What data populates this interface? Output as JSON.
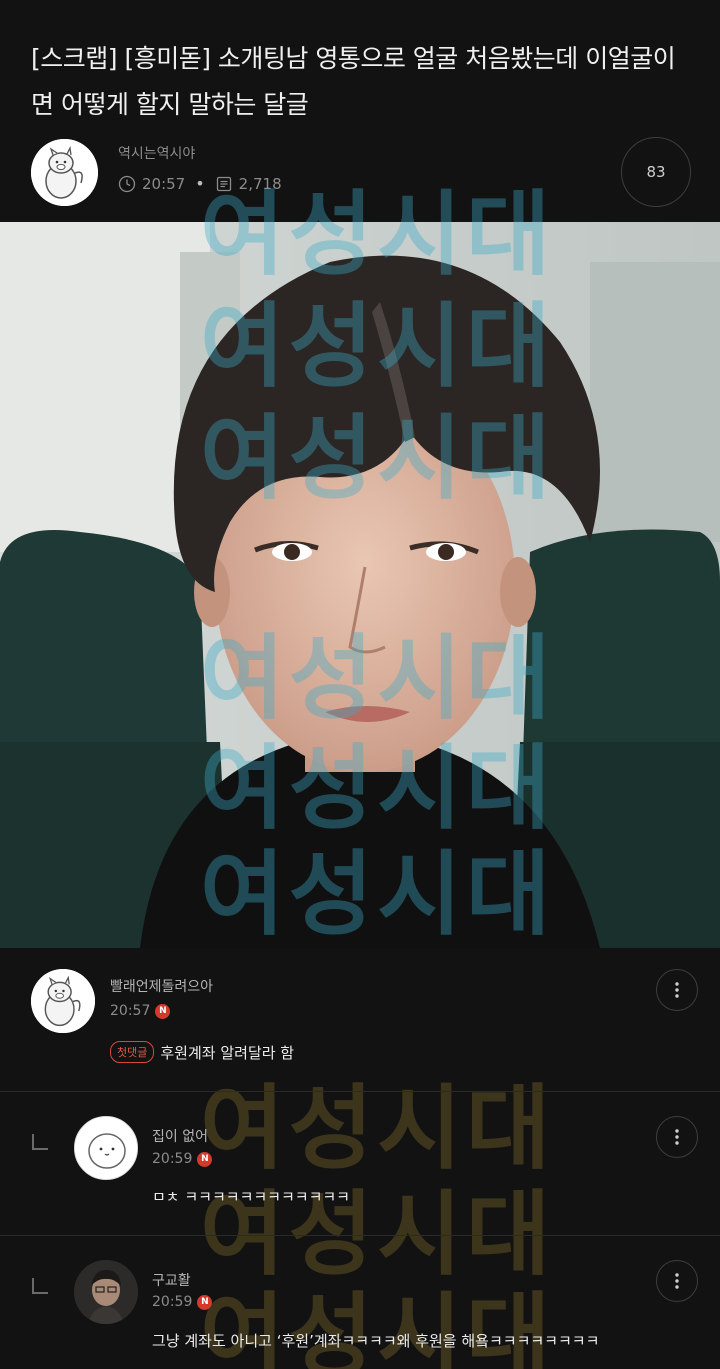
{
  "post": {
    "title": "[스크랩] [흥미돋] 소개팅남 영통으로 얼굴 처음봤는데 이얼굴이면 어떻게 할지 말하는 달글",
    "author": "역시는역시야",
    "time": "20:57",
    "views": "2,718",
    "comment_count": "83"
  },
  "watermark_text": "여성시대",
  "comments": [
    {
      "author": "빨래언제돌려으아",
      "time": "20:57",
      "badge": "N",
      "tag": "첫댓글",
      "text": "후원계좌 알려달라 함"
    },
    {
      "author": "집이 없어",
      "time": "20:59",
      "badge": "N",
      "text": "ㅁㅊ ㅋㅋㅋㅋㅋㅋㅋㅋㅋㅋㅋㅋ"
    },
    {
      "author": "구교활",
      "time": "20:59",
      "badge": "N",
      "text": "그냥 계좌도 아니고 ‘후원’계좌ㅋㅋㅋㅋ왜 후원을 해욬ㅋㅋㅋㅋㅋㅋㅋㅋ"
    }
  ],
  "icons": {
    "clock": "clock-icon",
    "views": "document-icon",
    "more": "more-vertical-icon",
    "reply": "reply-arrow-icon"
  },
  "colors": {
    "background": "#121212",
    "badge_red": "#d33a2c",
    "muted_text": "#8c8c8c"
  }
}
